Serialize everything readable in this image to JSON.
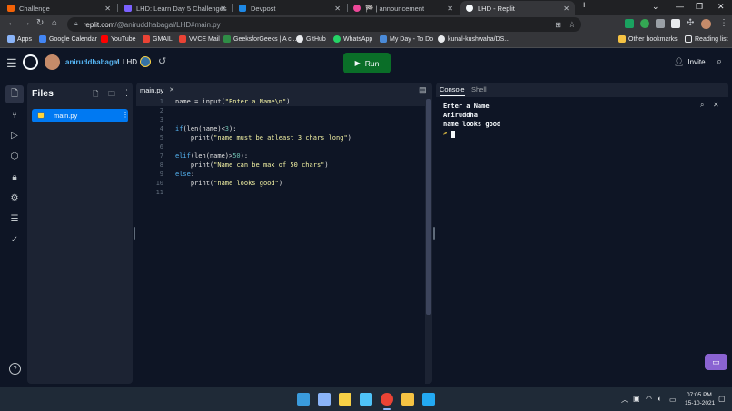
{
  "browser": {
    "tabs": [
      {
        "title": "Challenge",
        "favicon_color": "#f26207"
      },
      {
        "title": "LHD: Learn Day 5 Challenges",
        "favicon_color": "#7b61ff"
      },
      {
        "title": "Devpost",
        "favicon_color": "#003e54"
      },
      {
        "title": "🏁 | announcement",
        "favicon_color": "#ec4899"
      },
      {
        "title": "LHD - Replit",
        "favicon_color": "#f5f9fc"
      }
    ],
    "new_tab_label": "+",
    "url_host": "replit.com",
    "url_path": "/@aniruddhabagal/LHD#main.py"
  },
  "bookmarks": [
    {
      "label": "Apps",
      "color": "#8ab4f8"
    },
    {
      "label": "Google Calendar",
      "color": "#4285f4"
    },
    {
      "label": "YouTube",
      "color": "#ff0000"
    },
    {
      "label": "GMAIL",
      "color": "#ea4335"
    },
    {
      "label": "VVCE Mail",
      "color": "#ea4335"
    },
    {
      "label": "GeeksforGeeks | A c...",
      "color": "#2f8d46"
    },
    {
      "label": "GitHub",
      "color": "#e8eaed"
    },
    {
      "label": "WhatsApp",
      "color": "#25d366"
    },
    {
      "label": "My Day - To Do",
      "color": "#4a8ad8"
    },
    {
      "label": "kunal-kushwaha/DS...",
      "color": "#e8eaed"
    }
  ],
  "other_bookmarks": "Other bookmarks",
  "reading_list": "Reading list",
  "replit": {
    "username": "aniruddhabagal",
    "separator": "/",
    "repl_name": "LHD",
    "run_label": "Run",
    "invite_label": "Invite",
    "accent": "#0eb33d"
  },
  "files_panel": {
    "title": "Files",
    "items": [
      {
        "name": "main.py",
        "selected": true
      }
    ]
  },
  "editor": {
    "tab_label": "main.py",
    "lines": [
      {
        "n": "1",
        "html": "name = input(<s>\"Enter a Name\\n\"</s>)"
      },
      {
        "n": "2",
        "html": ""
      },
      {
        "n": "3",
        "html": ""
      },
      {
        "n": "4",
        "html": "<k>if</k>(len(name)<<n>3</n>):"
      },
      {
        "n": "5",
        "html": "    print(<s>\"name must be atleast 3 chars long\"</s>)"
      },
      {
        "n": "6",
        "html": ""
      },
      {
        "n": "7",
        "html": "<k>elif</k>(len(name)><n>50</n>):"
      },
      {
        "n": "8",
        "html": "    print(<s>\"Name can be max of 50 chars\"</s>)"
      },
      {
        "n": "9",
        "html": "<k>else</k>:"
      },
      {
        "n": "10",
        "html": "    print(<s>\"name looks good\"</s>)"
      },
      {
        "n": "11",
        "html": ""
      }
    ]
  },
  "console": {
    "tabs": [
      {
        "label": "Console",
        "active": true
      },
      {
        "label": "Shell",
        "active": false
      }
    ],
    "output": [
      "Enter a Name",
      "Aniruddha",
      "name looks good"
    ],
    "prompt": ">"
  },
  "taskbar": {
    "time": "07:05 PM",
    "date": "15-10-2021",
    "apps": [
      {
        "name": "windows-start-icon",
        "color": "#3a9bdc"
      },
      {
        "name": "task-view-icon",
        "color": "#8ab4f8"
      },
      {
        "name": "sticky-notes-icon",
        "color": "#f7d046"
      },
      {
        "name": "monitor-icon",
        "color": "#4fc3f7"
      },
      {
        "name": "chrome-icon",
        "color": "#ea4335"
      },
      {
        "name": "file-explorer-icon",
        "color": "#f6c343"
      },
      {
        "name": "vscode-icon",
        "color": "#23a9f2"
      }
    ]
  }
}
